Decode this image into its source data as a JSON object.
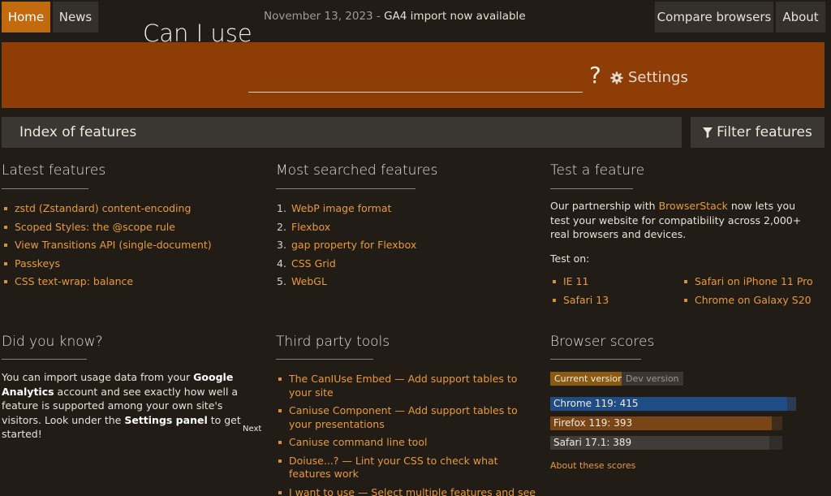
{
  "nav": {
    "home": "Home",
    "news": "News",
    "compare": "Compare browsers",
    "about": "About"
  },
  "announcement": {
    "date": "November 13, 2023 - ",
    "text": "GA4 import now available"
  },
  "hero": {
    "label": "Can I use",
    "question": "?",
    "settings": "Settings",
    "input_value": ""
  },
  "index_bar": {
    "label": "Index of features",
    "filter": "Filter features"
  },
  "latest": {
    "title": "Latest features",
    "items": [
      "zstd (Zstandard) content-encoding",
      "Scoped Styles: the @scope rule",
      "View Transitions API (single-document)",
      "Passkeys",
      "CSS text-wrap: balance"
    ]
  },
  "most_searched": {
    "title": "Most searched features",
    "items": [
      {
        "num": "1.",
        "label": "WebP image format"
      },
      {
        "num": "2.",
        "label": "Flexbox"
      },
      {
        "num": "3.",
        "label": "gap property for Flexbox"
      },
      {
        "num": "4.",
        "label": "CSS Grid"
      },
      {
        "num": "5.",
        "label": "WebGL"
      }
    ]
  },
  "test": {
    "title": "Test a feature",
    "text_before": "Our partnership with ",
    "link": "BrowserStack",
    "text_after": " now lets you test your website for compatibility across 2,000+ real browsers and devices.",
    "test_on": "Test on:",
    "col1": [
      "IE 11",
      "Safari 13"
    ],
    "col2": [
      "Safari on iPhone 11 Pro",
      "Chrome on Galaxy S20"
    ]
  },
  "did_you_know": {
    "title": "Did you know?",
    "p1": "You can import usage data from your ",
    "b1": "Google Analytics",
    "p2": " account and see exactly how well a feature is supported among your own site's visitors. Look under the ",
    "b2": "Settings panel",
    "p3": " to get started!",
    "next": "Next"
  },
  "third_party": {
    "title": "Third party tools",
    "items": [
      "The CanIUse Embed — Add support tables to your site",
      "Caniuse Component — Add support tables to your presentations",
      "Caniuse command line tool",
      "Doiuse...? — Lint your CSS to check what features work",
      "I want to use — Select multiple features and see what % of users can use them"
    ]
  },
  "scores": {
    "title": "Browser scores",
    "tab_current": "Current version",
    "tab_dev": "Dev version",
    "about": "About these scores",
    "bars": [
      {
        "label": "Chrome 119: 415",
        "value": 415,
        "max": 430,
        "fill": "#1f4c85",
        "track": "#2b3b55"
      },
      {
        "label": "Firefox 119: 393",
        "value": 393,
        "max": 412,
        "fill": "#7a4514",
        "track": "#3f2c1c"
      },
      {
        "label": "Safari 17.1: 389",
        "value": 389,
        "max": 412,
        "fill": "#403d39",
        "track": "#302d2a"
      }
    ]
  }
}
